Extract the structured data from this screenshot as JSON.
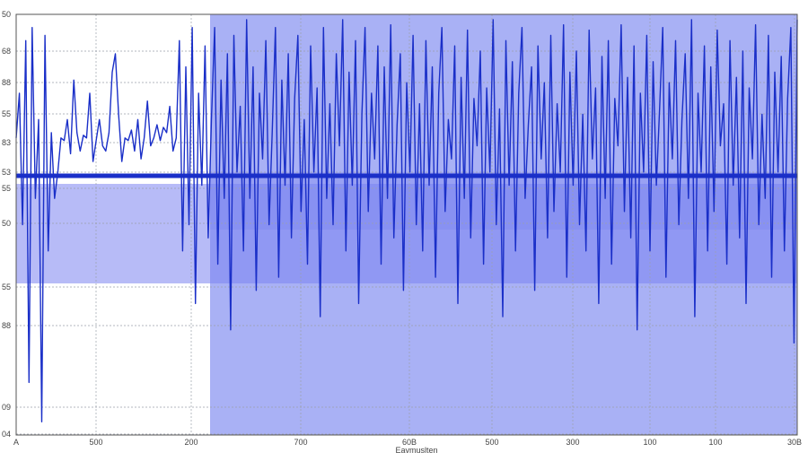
{
  "chart_data": {
    "type": "line",
    "title": "",
    "xlabel": "Eavmuslten",
    "ylabel": "",
    "grid": true,
    "colors": {
      "line": "#1a2fc8",
      "band": "#7c84f0",
      "region": "#9aa3f3",
      "grid": "#9aa0aa",
      "frame": "#555555"
    },
    "x_ticks": [
      "A",
      "500",
      "200",
      "700",
      "60B",
      "500",
      "300",
      "100",
      "100",
      "30B"
    ],
    "y_ticks": [
      "50",
      "68",
      "88",
      "55",
      "83",
      "53",
      "55",
      "50",
      "55",
      "88",
      "09",
      "04"
    ],
    "highlight_regions": [
      {
        "from_tick": 2,
        "to_tick": 9,
        "label": ""
      }
    ],
    "bands": [
      {
        "from_y_tick": 6,
        "to_y_tick": 8
      },
      {
        "from_y_tick": 5,
        "to_y_tick": 7
      }
    ],
    "series": [
      {
        "values": [
          53,
          70,
          20,
          90,
          -40,
          95,
          30,
          60,
          -55,
          92,
          10,
          55,
          30,
          40,
          53,
          52,
          60,
          47,
          75,
          55,
          48,
          54,
          53,
          70,
          44,
          52,
          60,
          50,
          48,
          55,
          78,
          85,
          62,
          44,
          53,
          52,
          56,
          48,
          60,
          45,
          53,
          67,
          50,
          53,
          58,
          52,
          57,
          55,
          65,
          48,
          53,
          90,
          10,
          80,
          20,
          95,
          -10,
          70,
          35,
          88,
          15,
          60,
          95,
          5,
          75,
          30,
          85,
          -20,
          92,
          40,
          65,
          10,
          98,
          30,
          80,
          -5,
          70,
          45,
          90,
          20,
          55,
          95,
          0,
          75,
          35,
          85,
          15,
          68,
          92,
          25,
          60,
          5,
          88,
          40,
          72,
          -15,
          95,
          30,
          66,
          20,
          85,
          50,
          98,
          10,
          78,
          35,
          90,
          -10,
          62,
          95,
          25,
          70,
          45,
          88,
          5,
          80,
          30,
          96,
          15,
          58,
          85,
          -5,
          74,
          40,
          92,
          20,
          66,
          10,
          90,
          35,
          80,
          0,
          70,
          95,
          25,
          60,
          45,
          88,
          -10,
          76,
          30,
          94,
          15,
          68,
          50,
          86,
          5,
          72,
          40,
          98,
          20,
          64,
          -15,
          90,
          35,
          82,
          10,
          70,
          95,
          30,
          58,
          80,
          -5,
          88,
          45,
          74,
          15,
          92,
          25,
          66,
          40,
          96,
          0,
          78,
          35,
          86,
          20,
          62,
          10,
          94,
          45,
          72,
          -10,
          84,
          30,
          90,
          5,
          68,
          50,
          96,
          25,
          76,
          15,
          88,
          -20,
          70,
          40,
          92,
          10,
          82,
          35,
          64,
          95,
          0,
          74,
          45,
          90,
          20,
          60,
          85,
          30,
          98,
          -15,
          70,
          40,
          88,
          10,
          80,
          25,
          94,
          50,
          66,
          5,
          90,
          35,
          76,
          15,
          86,
          -10,
          72,
          45,
          96,
          20,
          62,
          30,
          92,
          0,
          78,
          40,
          84,
          10,
          68,
          95,
          -25,
          98
        ]
      }
    ]
  }
}
